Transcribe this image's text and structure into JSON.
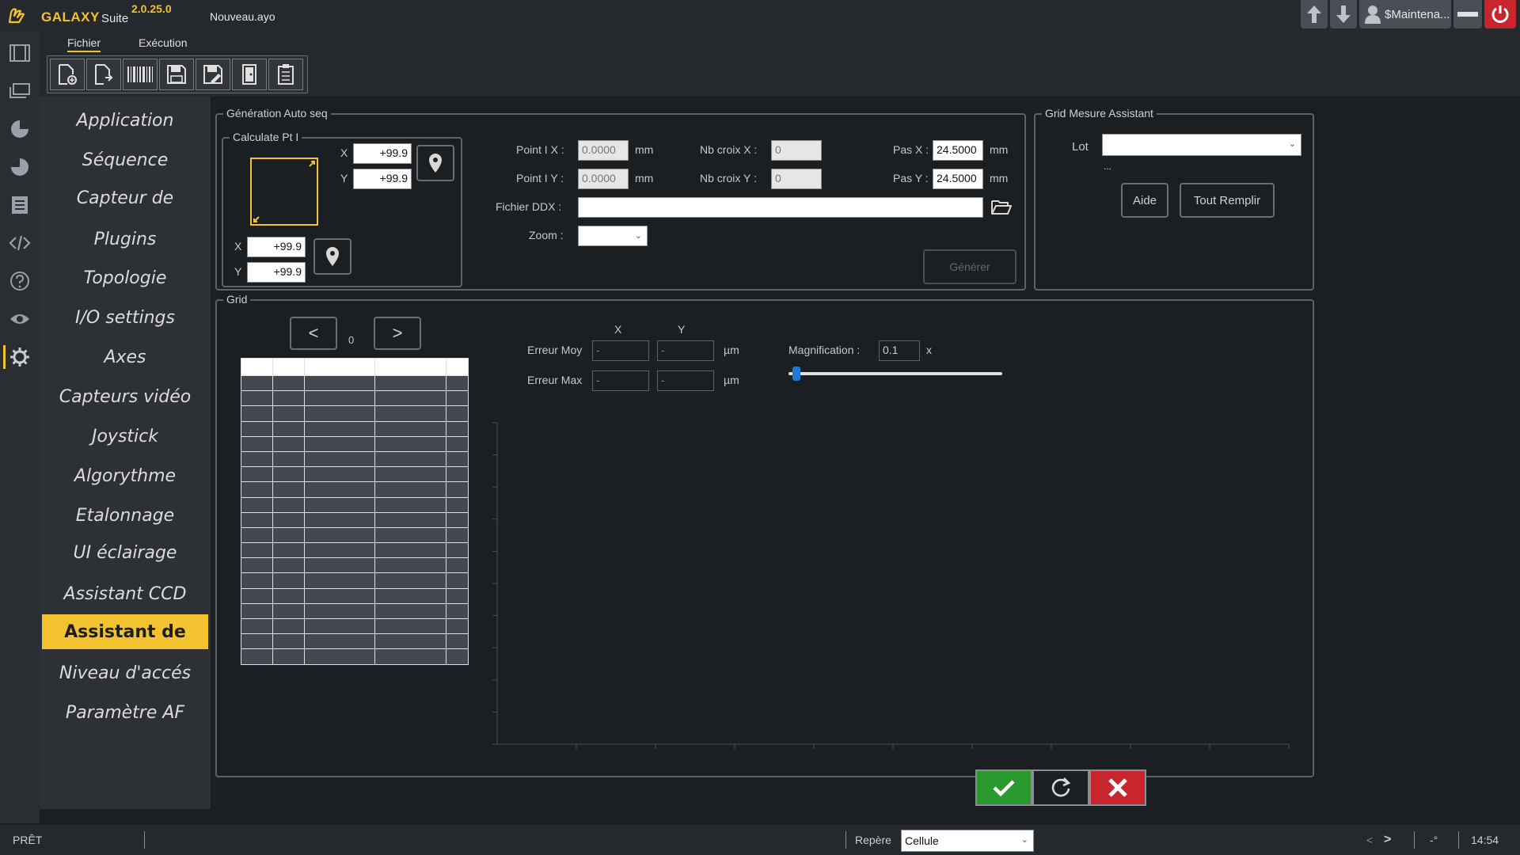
{
  "app": {
    "name": "GALAXY",
    "suite": "Suite",
    "version": "2.0.25.0",
    "file": "Nouveau.ayo",
    "user": "$Maintena...",
    "accent": "#f2c230"
  },
  "menu": {
    "tabs": [
      {
        "label": "Fichier",
        "active": true
      },
      {
        "label": "Exécution",
        "active": false
      }
    ],
    "tools": [
      "new-file-icon",
      "import-file-icon",
      "barcode-icon",
      "save-icon",
      "save-as-icon",
      "exit-door-icon",
      "checklist-icon"
    ]
  },
  "iconstrip": [
    "film-icon",
    "stack-icon",
    "pie-chart-icon",
    "pie-chart-alt-icon",
    "document-list-icon",
    "code-icon",
    "help-icon",
    "eye-icon",
    "gear-icon"
  ],
  "nav": {
    "items": [
      {
        "label": "Application"
      },
      {
        "label": "Séquence"
      },
      {
        "label": "Capteur de"
      },
      {
        "label": "Plugins"
      },
      {
        "label": "Topologie"
      },
      {
        "label": "I/O settings"
      },
      {
        "label": "Axes"
      },
      {
        "label": "Capteurs vidéo"
      },
      {
        "label": "Joystick"
      },
      {
        "label": "Algorythme"
      },
      {
        "label": "Etalonnage"
      },
      {
        "label": "UI éclairage"
      },
      {
        "label": "Assistant CCD"
      },
      {
        "label": "Assistant de",
        "active": true
      },
      {
        "label": "Niveau d'accés"
      },
      {
        "label": "Paramètre AF"
      }
    ]
  },
  "autoseq": {
    "title": "Génération Auto seq",
    "calc": {
      "title": "Calculate Pt I",
      "x_label": "X",
      "y_label": "Y",
      "top_x": "+99.9",
      "top_y": "+99.9",
      "bottom_x": "+99.9",
      "bottom_y": "+99.9"
    },
    "point_ix_label": "Point I X :",
    "point_ix_value": "0.0000",
    "point_iy_label": "Point I Y :",
    "point_iy_value": "0.0000",
    "unit_mm": "mm",
    "nb_croix_x_label": "Nb croix X :",
    "nb_croix_x_value": "0",
    "nb_croix_y_label": "Nb croix Y :",
    "nb_croix_y_value": "0",
    "pas_x_label": "Pas X :",
    "pas_x_value": "24.5000",
    "pas_y_label": "Pas Y :",
    "pas_y_value": "24.5000",
    "fichier_label": "Fichier DDX :",
    "fichier_value": "",
    "zoom_label": "Zoom :",
    "zoom_value": "",
    "generate_label": "Générer"
  },
  "assistant": {
    "title": "Grid Mesure Assistant",
    "lot_label": "Lot",
    "lot_value": "",
    "ellipsis": "...",
    "aide_label": "Aide",
    "fill_label": "Tout Remplir"
  },
  "grid": {
    "title": "Grid",
    "prev_label": "<",
    "next_label": ">",
    "page": "0",
    "col_x": "X",
    "col_y": "Y",
    "err_moy_label": "Erreur Moy",
    "err_max_label": "Erreur Max",
    "err_moy_x": "-",
    "err_moy_y": "-",
    "err_max_x": "-",
    "err_max_y": "-",
    "unit_um": "µm",
    "mag_label": "Magnification :",
    "mag_value": "0.1",
    "mag_unit": "x",
    "slider_position": 0.02,
    "table_rows": 19,
    "table_cols": 5
  },
  "statusbar": {
    "status": "PRÊT",
    "repere_label": "Repère",
    "repere_value": "Cellule",
    "nav_prev": "<",
    "nav_next": ">",
    "angle": "-°",
    "time": "14:54"
  }
}
